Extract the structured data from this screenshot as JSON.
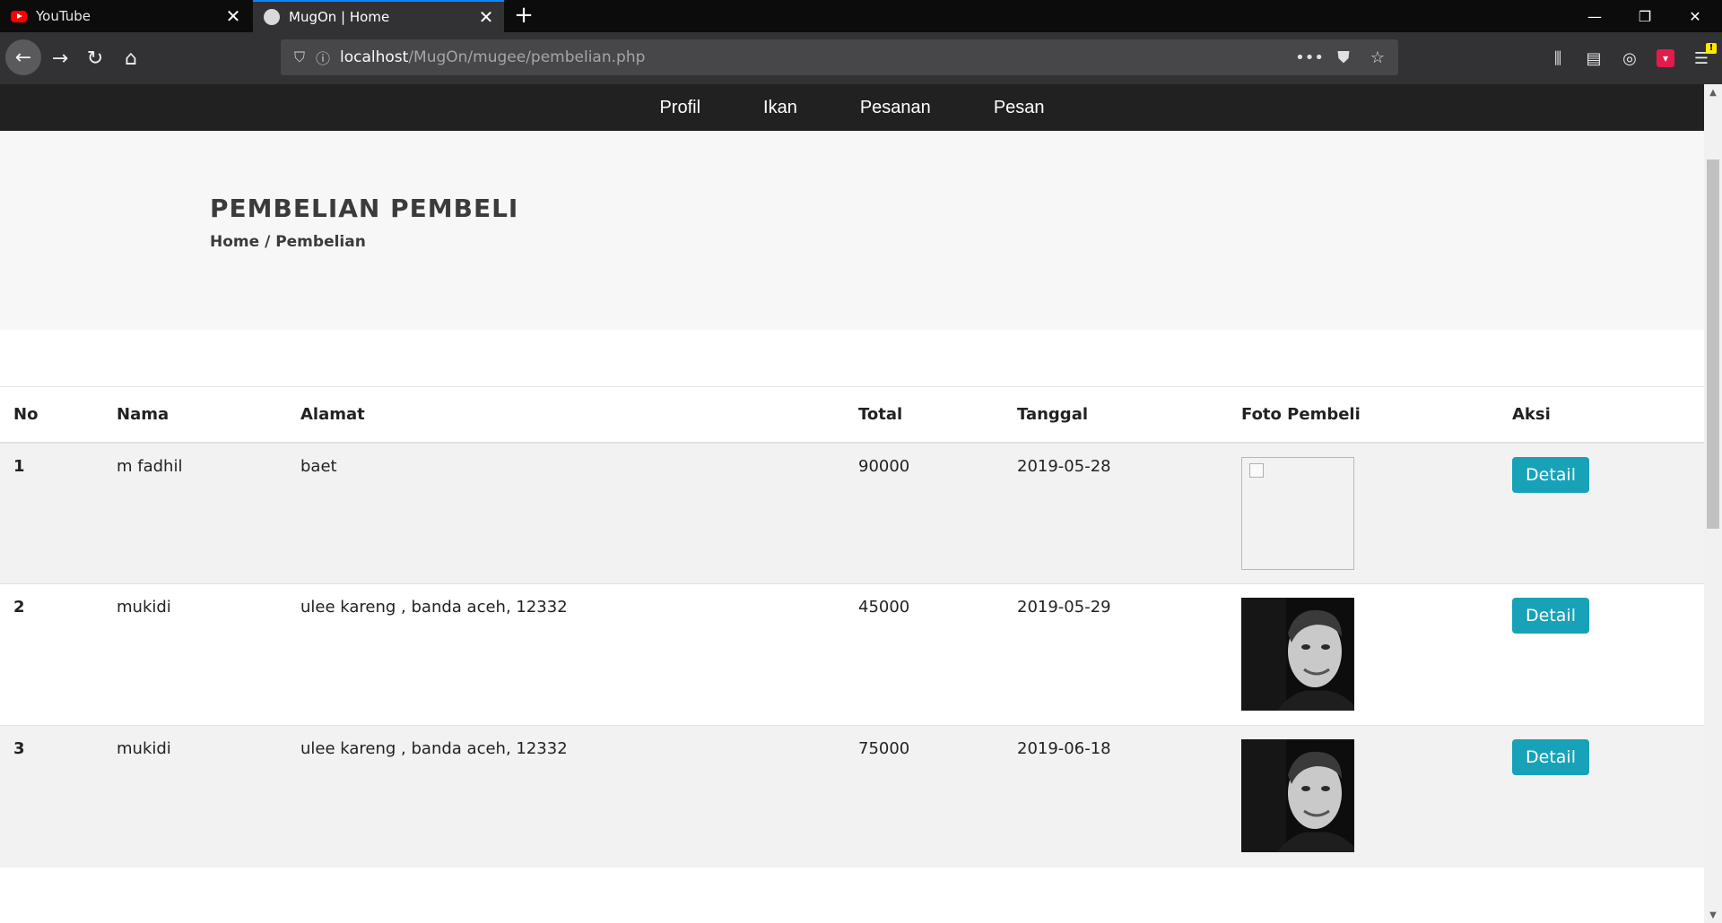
{
  "browser": {
    "tabs": [
      {
        "title": "YouTube",
        "active": false
      },
      {
        "title": "MugOn | Home",
        "active": true
      }
    ],
    "url": {
      "host": "localhost",
      "path": "/MugOn/mugee/pembelian.php"
    }
  },
  "site_nav": [
    "Profil",
    "Ikan",
    "Pesanan",
    "Pesan"
  ],
  "hero": {
    "title": "PEMBELIAN PEMBELI",
    "breadcrumb": "Home / Pembelian"
  },
  "table": {
    "headers": [
      "No",
      "Nama",
      "Alamat",
      "Total",
      "Tanggal",
      "Foto Pembeli",
      "Aksi"
    ],
    "rows": [
      {
        "no": "1",
        "nama": "m fadhil",
        "alamat": "baet",
        "total": "90000",
        "tanggal": "2019-05-28",
        "foto": "broken",
        "aksi": "Detail"
      },
      {
        "no": "2",
        "nama": "mukidi",
        "alamat": "ulee kareng , banda aceh, 12332",
        "total": "45000",
        "tanggal": "2019-05-29",
        "foto": "man-portrait",
        "aksi": "Detail"
      },
      {
        "no": "3",
        "nama": "mukidi",
        "alamat": "ulee kareng , banda aceh, 12332",
        "total": "75000",
        "tanggal": "2019-06-18",
        "foto": "man-portrait",
        "aksi": "Detail"
      }
    ]
  },
  "colors": {
    "accent": "#17a2b8",
    "nav_bg": "#212121",
    "hero_bg": "#f7f7f7",
    "tab_highlight": "#0a84ff"
  }
}
